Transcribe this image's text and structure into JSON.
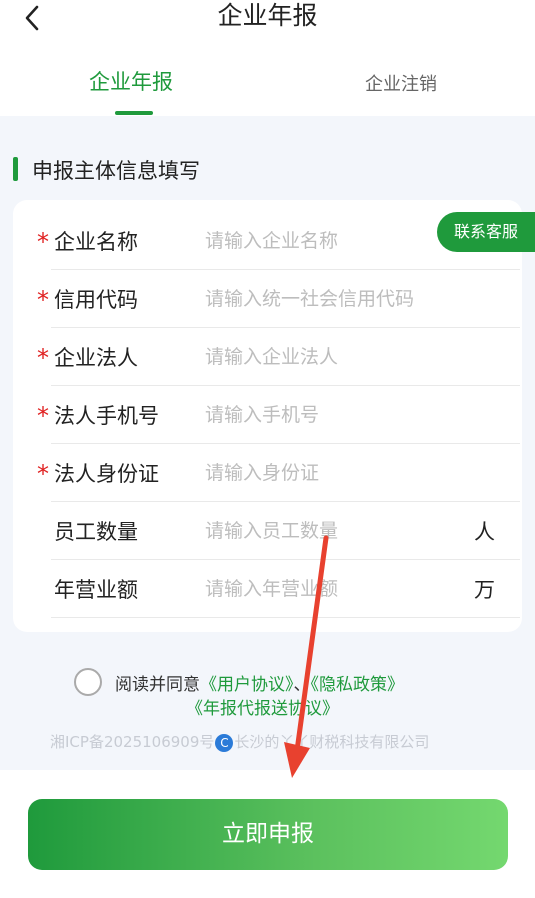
{
  "header": {
    "title": "企业年报",
    "back_icon": "chevron-left-icon"
  },
  "tabs": [
    {
      "label": "企业年报",
      "active": true
    },
    {
      "label": "企业注销",
      "active": false
    }
  ],
  "section": {
    "title": "申报主体信息填写"
  },
  "contact_button": {
    "label": "联系客服"
  },
  "form": {
    "rows": [
      {
        "label": "企业名称",
        "required": "*",
        "placeholder": "请输入企业名称",
        "unit": ""
      },
      {
        "label": "信用代码",
        "required": "*",
        "placeholder": "请输入统一社会信用代码",
        "unit": ""
      },
      {
        "label": "企业法人",
        "required": "*",
        "placeholder": "请输入企业法人",
        "unit": ""
      },
      {
        "label": "法人手机号",
        "required": "*",
        "placeholder": "请输入手机号",
        "unit": ""
      },
      {
        "label": "法人身份证",
        "required": "*",
        "placeholder": "请输入身份证",
        "unit": ""
      },
      {
        "label": "员工数量",
        "required": "",
        "placeholder": "请输入员工数量",
        "unit": "人"
      },
      {
        "label": "年营业额",
        "required": "",
        "placeholder": "请输入年营业额",
        "unit": "万"
      }
    ]
  },
  "agreement": {
    "prefix": "阅读并同意",
    "link_user": "《用户协议》",
    "separator": "、",
    "link_privacy": "《隐私政策》",
    "link_report": "《年报代报送协议》"
  },
  "footer": {
    "icp": "湘ICP备2025106909号",
    "company": "长沙的丫丫财税科技有限公司",
    "icp_symbol": "C"
  },
  "submit": {
    "label": "立即申报"
  },
  "colors": {
    "accent": "#1f9a3c",
    "required": "#e02020",
    "annotation_arrow": "#e8412f"
  }
}
